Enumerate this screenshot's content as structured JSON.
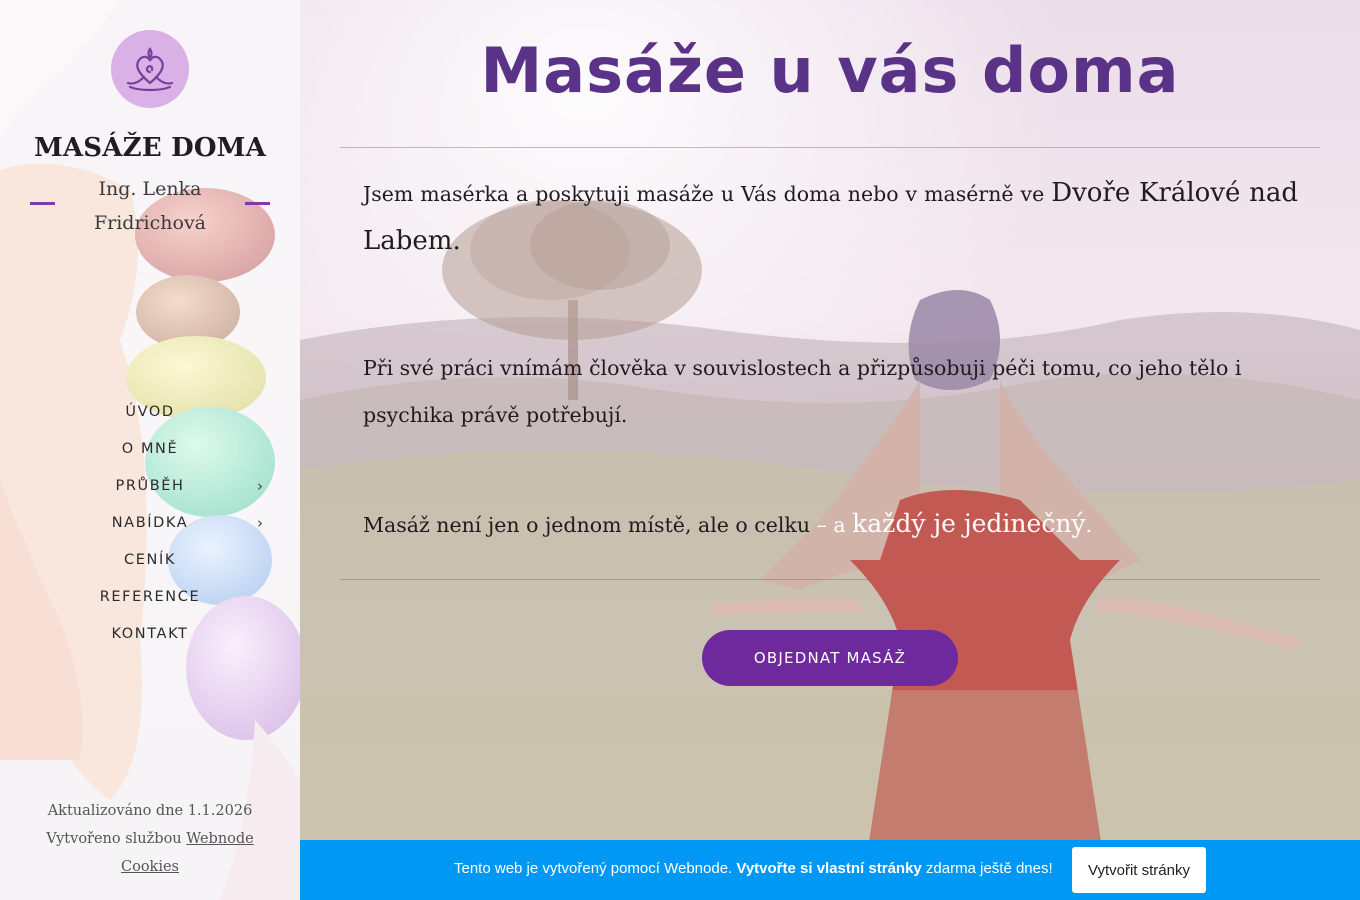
{
  "sidebar": {
    "logo_icon": "lotus-heart-icon",
    "title": "MASÁŽE DOMA",
    "subtitle_line1": "Ing. Lenka",
    "subtitle_line2": "Fridrichová",
    "nav": [
      {
        "label": "ÚVOD",
        "has_submenu": false
      },
      {
        "label": "O MNĚ",
        "has_submenu": false
      },
      {
        "label": "PRŮBĚH",
        "has_submenu": true
      },
      {
        "label": "NABÍDKA",
        "has_submenu": true
      },
      {
        "label": "CENÍK",
        "has_submenu": false
      },
      {
        "label": "REFERENCE",
        "has_submenu": false
      },
      {
        "label": "KONTAKT",
        "has_submenu": false
      }
    ],
    "chevron": "›",
    "footer": {
      "updated": "Aktualizováno dne 1.1.2026",
      "created_prefix": "Vytvořeno službou",
      "webnode_link": "Webnode",
      "cookies_link": "Cookies"
    }
  },
  "main": {
    "headline": "Masáže u vás doma",
    "p1_text": "Jsem masérka a poskytuji masáže u Vás doma nebo v masérně ve",
    "p1_emph": "Dvoře Králové nad Labem.",
    "p2_text": "Při své práci vnímám člověka v souvislostech a přizpůsobuji péči tomu, co jeho tělo i psychika právě potřebují.",
    "p3_text": "Masáž není jen o jednom místě, ale o celku",
    "p3_dash": " – a ",
    "p3_emph": "každý je jedinečný",
    "p3_dot": ".",
    "cta_label": "OBJEDNAT MASÁŽ"
  },
  "banner": {
    "text_prefix": "Tento web je vytvořený pomocí Webnode. ",
    "text_bold": "Vytvořte si vlastní stránky",
    "text_suffix": " zdarma ještě dnes!",
    "button_label": "Vytvořit stránky"
  },
  "colors": {
    "accent_purple": "#6e2a9c",
    "headline_purple": "#5a3288",
    "banner_blue": "#0097f5"
  }
}
